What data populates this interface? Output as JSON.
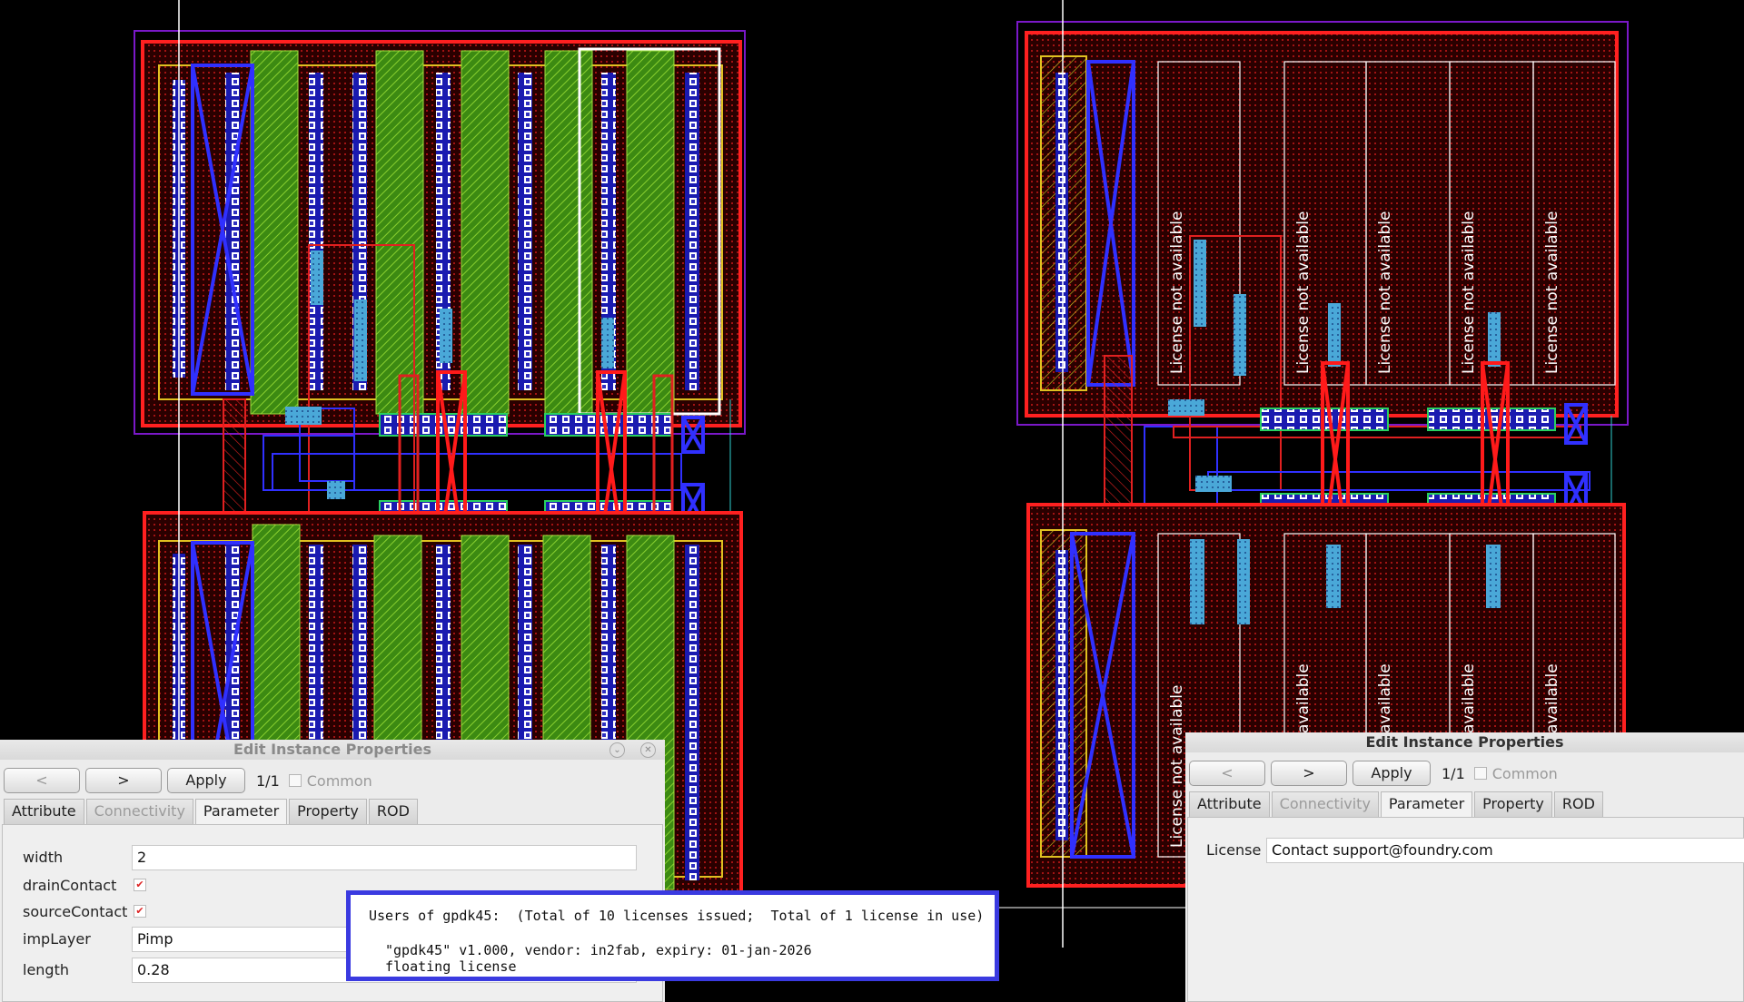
{
  "colors": {
    "background": "#000000",
    "nwell": "#ff2020",
    "metal1": "#3030ff",
    "poly": "#e01010",
    "active": "#28d060",
    "implant": "#7a18c8",
    "contact": "#4aa8d8",
    "ruler": "#ffffff"
  },
  "layout": {
    "placeholder_label": "License not available",
    "placeholder_label_cut": "available"
  },
  "dialog_left": {
    "title": "Edit Instance Properties",
    "prev_label": "<",
    "next_label": ">",
    "apply_label": "Apply",
    "count": "1/1",
    "common_label": "Common",
    "tabs": [
      "Attribute",
      "Connectivity",
      "Parameter",
      "Property",
      "ROD"
    ],
    "active_tab": "Parameter",
    "params": {
      "width_label": "width",
      "width_value": "2",
      "drain_label": "drainContact",
      "drain_checked": "✔",
      "source_label": "sourceContact",
      "source_checked": "✔",
      "imp_label": "impLayer",
      "imp_value": "Pimp",
      "length_label": "length",
      "length_value": "0.28"
    }
  },
  "dialog_right": {
    "title": "Edit Instance Properties",
    "prev_label": "<",
    "next_label": ">",
    "apply_label": "Apply",
    "count": "1/1",
    "common_label": "Common",
    "tabs": [
      "Attribute",
      "Connectivity",
      "Parameter",
      "Property",
      "ROD"
    ],
    "active_tab": "Parameter",
    "license_label": "License",
    "license_value": "Contact support@foundry.com"
  },
  "license_popup": {
    "line1": "Users of gpdk45:  (Total of 10 licenses issued;  Total of 1 license in use)",
    "line2": "\"gpdk45\" v1.000, vendor: in2fab, expiry: 01-jan-2026",
    "line3": "floating license"
  }
}
